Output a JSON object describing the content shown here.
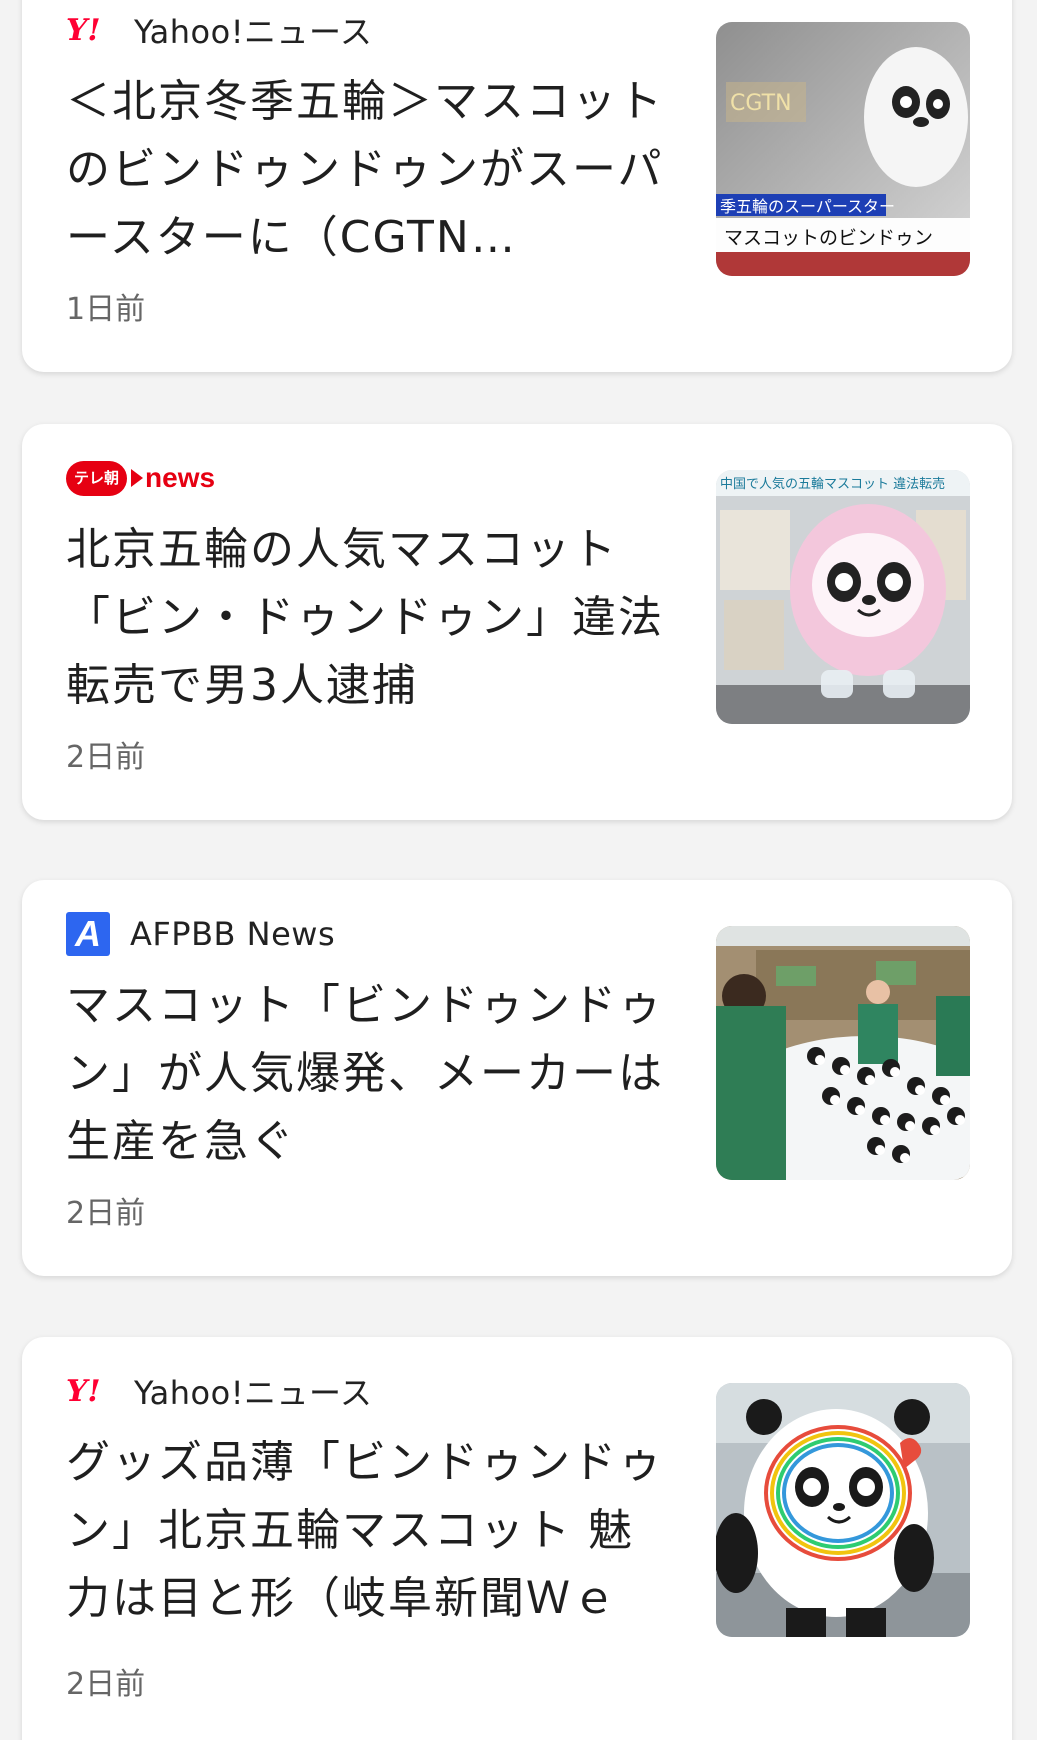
{
  "articles": [
    {
      "source": "Yahoo!ニュース",
      "source_logo": "Y!",
      "title": "＜北京冬季五輪＞マスコットのビンドゥンドゥンがスーパースターに（CGTN…",
      "time": "1日前",
      "thumb_caption_1": "CGTN",
      "thumb_caption_2": "季五輪のスーパースター",
      "thumb_caption_3": "マスコットのビンドゥン"
    },
    {
      "source": "",
      "source_logo_circle": "テレ朝",
      "source_logo_text": "news",
      "title": "北京五輪の人気マスコット「ビン・ドゥンドゥン」違法転売で男3人逮捕",
      "time": "2日前",
      "thumb_caption_1": "中国で人気の五輪マスコット 違法転売"
    },
    {
      "source": "AFPBB News",
      "source_logo": "A",
      "title": "マスコット「ビンドゥンドゥン」が人気爆発、メーカーは生産を急ぐ",
      "time": "2日前"
    },
    {
      "source": "Yahoo!ニュース",
      "source_logo": "Y!",
      "title": "グッズ品薄「ビンドゥンドゥン」北京五輪マスコット 魅力は目と形（岐阜新聞Ｗｅｂ…",
      "time": "2日前"
    }
  ]
}
